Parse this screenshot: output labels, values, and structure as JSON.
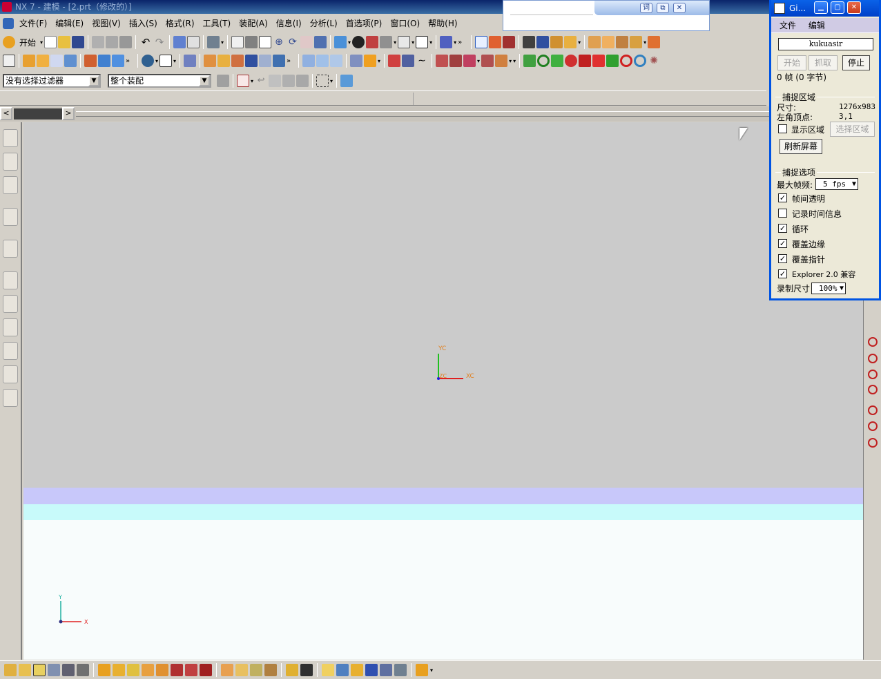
{
  "window": {
    "title": "NX 7 - 建模 - [2.prt（修改的）]"
  },
  "menu": [
    "文件(F)",
    "编辑(E)",
    "视图(V)",
    "插入(S)",
    "格式(R)",
    "工具(T)",
    "装配(A)",
    "信息(I)",
    "分析(L)",
    "首选项(P)",
    "窗口(O)",
    "帮助(H)"
  ],
  "toolbar": {
    "start_label": "开始"
  },
  "filters": {
    "selection_filter": "没有选择过滤器",
    "scope": "整个装配"
  },
  "viewport": {
    "wcs": {
      "x": "XC",
      "y": "YC",
      "z": "ZC"
    },
    "abs": {
      "x": "X",
      "y": "Y"
    }
  },
  "popup": {
    "btn1": "词",
    "btn2": "⧉",
    "btn3": "✕"
  },
  "gif": {
    "title": "Gi...",
    "menu": [
      "文件",
      "编辑"
    ],
    "field": "kukuasir",
    "btn_start": "开始",
    "btn_grab": "抓取",
    "btn_stop": "停止",
    "frames": "0 帧 (0 字节)",
    "capture_group": "捕捉区域",
    "size_label": "尺寸:",
    "size_value": "1276x983",
    "corner_label": "左角顶点:",
    "corner_value": "3,1",
    "show_region": "显示区域",
    "select_region": "选择区域",
    "refresh": "刷新屏幕",
    "options_group": "捕捉选项",
    "max_fps_label": "最大帧频:",
    "max_fps_value": "5 fps",
    "opt_transparent": "帧间透明",
    "opt_time": "记录时间信息",
    "opt_loop": "循环",
    "opt_edge": "覆盖边缘",
    "opt_pointer": "覆盖指针",
    "opt_explorer": "Explorer 2.0 兼容",
    "rec_size_label": "录制尺寸",
    "rec_size_value": "100%"
  }
}
